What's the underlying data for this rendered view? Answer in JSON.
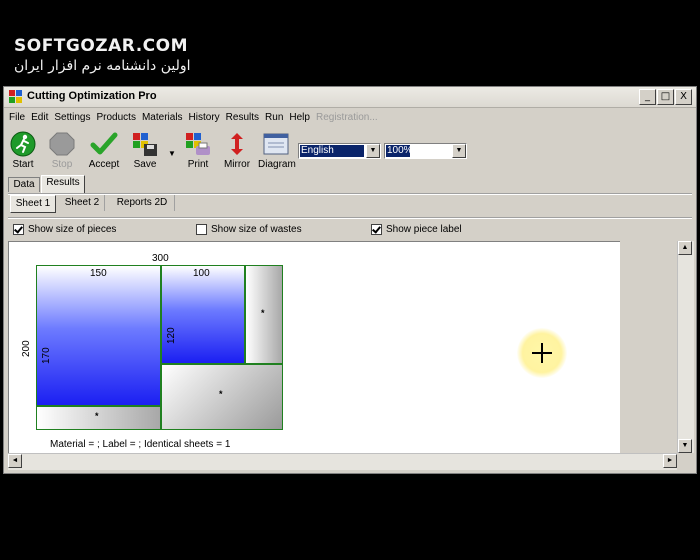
{
  "watermark": {
    "brand": "SOFTGOZAR.COM",
    "subtitle": "اولین دانشنامه نرم افزار ایران"
  },
  "window": {
    "title": "Cutting Optimization Pro",
    "controls": {
      "minimize": "_",
      "maximize": "□",
      "close": "X"
    }
  },
  "menu": [
    {
      "label": "File"
    },
    {
      "label": "Edit"
    },
    {
      "label": "Settings"
    },
    {
      "label": "Products"
    },
    {
      "label": "Materials"
    },
    {
      "label": "History"
    },
    {
      "label": "Results"
    },
    {
      "label": "Run"
    },
    {
      "label": "Help"
    },
    {
      "label": "Registration...",
      "disabled": true
    }
  ],
  "toolbar": {
    "start": "Start",
    "stop": "Stop",
    "accept": "Accept",
    "save": "Save",
    "print": "Print",
    "mirror": "Mirror",
    "diagram": "Diagram",
    "language": "English",
    "zoom": "100%"
  },
  "tabs": [
    {
      "label": "Data"
    },
    {
      "label": "Results",
      "active": true
    }
  ],
  "subtabs": [
    {
      "label": "Sheet 1",
      "active": true
    },
    {
      "label": "Sheet 2"
    },
    {
      "label": "Reports 2D"
    }
  ],
  "options": [
    {
      "label": "Show size of pieces",
      "checked": true
    },
    {
      "label": "Show size of wastes",
      "checked": false
    },
    {
      "label": "Show piece label",
      "checked": true
    }
  ],
  "sheet": {
    "width_label": "300",
    "height_label": "200",
    "pieces": [
      {
        "width": "150",
        "height": "170"
      },
      {
        "width": "100",
        "height": "120"
      }
    ],
    "waste_mark": "*",
    "footer": "Material =  ; Label =  ; Identical sheets  = 1"
  },
  "scroll": {
    "up": "▲",
    "down": "▼",
    "left": "◄",
    "right": "►"
  },
  "colors": {
    "piece_fill": "#1b1ff2",
    "piece_border": "#208020",
    "selection": "#0a246a"
  }
}
